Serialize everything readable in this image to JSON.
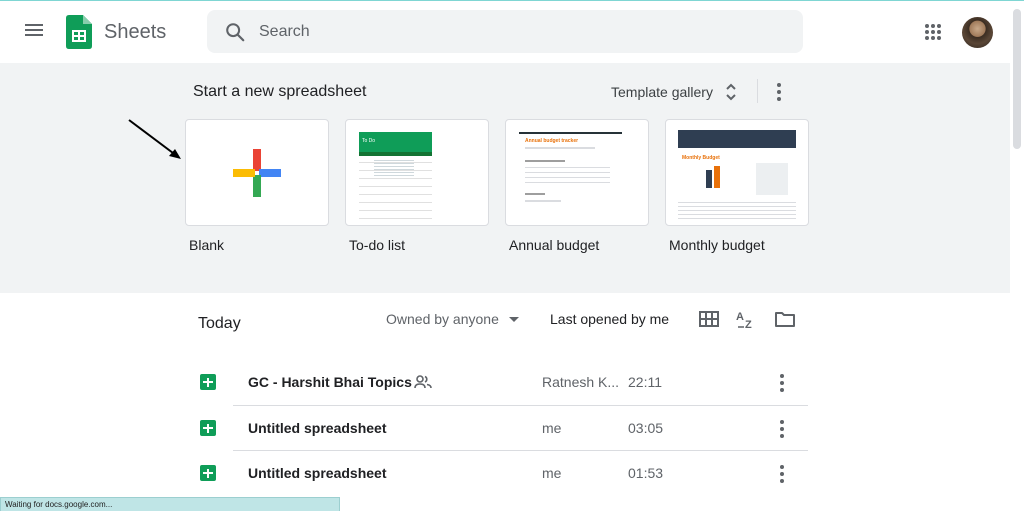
{
  "header": {
    "app_name": "Sheets",
    "search_placeholder": "Search"
  },
  "templates": {
    "title": "Start a new spreadsheet",
    "gallery_label": "Template gallery",
    "items": [
      {
        "label": "Blank"
      },
      {
        "label": "To-do list",
        "thumb_title": "To Do"
      },
      {
        "label": "Annual budget",
        "thumb_title": "Annual budget tracker"
      },
      {
        "label": "Monthly budget",
        "thumb_title": "Monthly Budget"
      }
    ]
  },
  "files": {
    "section_label": "Today",
    "owner_filter": "Owned by anyone",
    "sort_label": "Last opened by me",
    "rows": [
      {
        "name": "GC - Harshit Bhai Topics",
        "owner": "Ratnesh K...",
        "time": "22:11",
        "shared": true
      },
      {
        "name": "Untitled spreadsheet",
        "owner": "me",
        "time": "03:05",
        "shared": false
      },
      {
        "name": "Untitled spreadsheet",
        "owner": "me",
        "time": "01:53",
        "shared": false
      }
    ]
  },
  "status_bar": "Waiting for docs.google.com...",
  "colors": {
    "sheets_green": "#0f9d58",
    "background_gray": "#f1f3f4"
  }
}
